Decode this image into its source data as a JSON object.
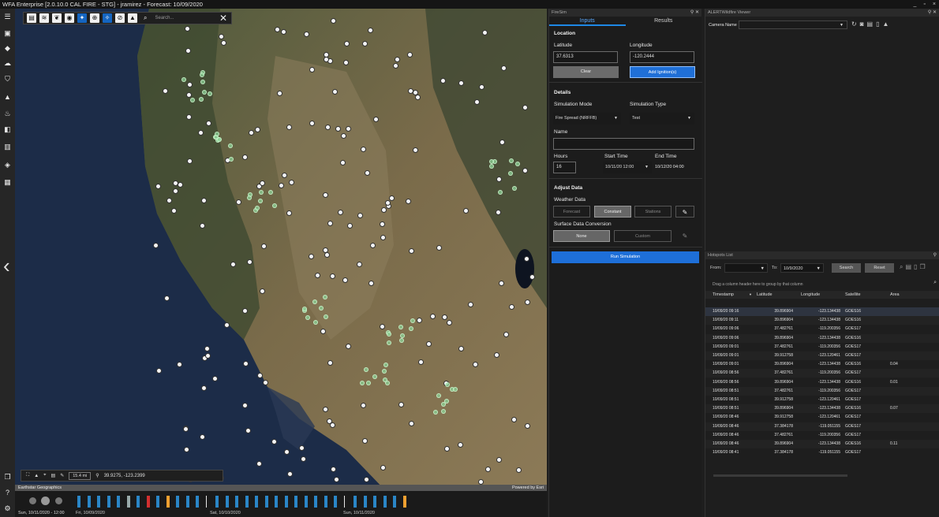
{
  "app": {
    "title": "WFA Enterprise [2.0.10.0 CAL FIRE - STG] - jramirez - Forecast: 10/09/2020"
  },
  "window_controls": [
    "_",
    "▫",
    "×"
  ],
  "map": {
    "search_placeholder": "Search...",
    "scale": "15.4 mi",
    "coords": "39.9275, -123.2399",
    "attribution_left": "Earthstar Geographics",
    "attribution_right": "Powered by Esri",
    "colors": {
      "ocean": "#1c2c48",
      "land": "#6b6346",
      "marker": "#f4f4f4",
      "hotspot": "#8fd29a"
    }
  },
  "timeline": {
    "current": "Sun, 10/11/2020 - 12:00",
    "dates": [
      "Fri, 10/09/2020",
      "Sat, 10/10/2020",
      "Sun, 10/11/2020"
    ]
  },
  "firesim": {
    "panel_title": "FireSim",
    "tabs": [
      "Inputs",
      "Results"
    ],
    "location": {
      "heading": "Location",
      "lat_label": "Latitude",
      "lat_value": "37.6313",
      "lon_label": "Longitude",
      "lon_value": "-120.2444",
      "clear": "Clear",
      "add": "Add Ignition(s)"
    },
    "details": {
      "heading": "Details",
      "mode_label": "Simulation Mode",
      "mode_value": "Fire Spread (NRFFB)",
      "type_label": "Simulation Type",
      "type_value": "Test",
      "name_label": "Name",
      "name_value": "",
      "hours_label": "Hours",
      "hours_value": "16",
      "start_label": "Start Time",
      "start_value": "10/11/20 12:00",
      "end_label": "End Time",
      "end_value": "10/12/20 04:00"
    },
    "adjust": {
      "heading": "Adjust Data",
      "weather_label": "Weather Data",
      "weather_opts": [
        "Forecast",
        "Constant",
        "Stations"
      ],
      "surface_label": "Surface Data Conversion",
      "surface_opts": [
        "None",
        "Custom"
      ]
    },
    "run": "Run Simulation"
  },
  "viewer": {
    "title": "ALERTWildfire Viewer",
    "camera_label": "Camera Name"
  },
  "hotspots": {
    "title": "Hotspots List",
    "from_label": "From:",
    "to_label": "To:",
    "to_value": "10/9/2020",
    "search": "Search",
    "reset": "Reset",
    "group_hint": "Drag a column header here to group by that column",
    "columns": [
      "Timestamp",
      "Latitude",
      "Longitude",
      "Satellite",
      "Area"
    ],
    "rows": [
      [
        "10/09/20 09:16",
        "39.896904",
        "-123.134438",
        "GOES16",
        ""
      ],
      [
        "10/09/20 09:11",
        "39.896904",
        "-123.134438",
        "GOES16",
        ""
      ],
      [
        "10/09/20 09:06",
        "37.482761",
        "-119.200356",
        "GOES17",
        ""
      ],
      [
        "10/09/20 09:06",
        "39.896904",
        "-123.134438",
        "GOES16",
        ""
      ],
      [
        "10/09/20 09:01",
        "37.482761",
        "-119.200356",
        "GOES17",
        ""
      ],
      [
        "10/09/20 09:01",
        "39.912758",
        "-123.120461",
        "GOES17",
        ""
      ],
      [
        "10/09/20 09:01",
        "39.896904",
        "-123.134438",
        "GOES16",
        "0.04"
      ],
      [
        "10/09/20 08:56",
        "37.482761",
        "-119.200356",
        "GOES17",
        ""
      ],
      [
        "10/09/20 08:56",
        "39.896904",
        "-123.134438",
        "GOES16",
        "0.01"
      ],
      [
        "10/09/20 08:51",
        "37.482761",
        "-119.200356",
        "GOES17",
        ""
      ],
      [
        "10/09/20 08:51",
        "39.912758",
        "-123.120461",
        "GOES17",
        ""
      ],
      [
        "10/09/20 08:51",
        "39.896904",
        "-123.134438",
        "GOES16",
        "0.07"
      ],
      [
        "10/09/20 08:46",
        "39.912758",
        "-123.120461",
        "GOES17",
        ""
      ],
      [
        "10/09/20 08:46",
        "37.384178",
        "-119.051155",
        "GOES17",
        ""
      ],
      [
        "10/09/20 08:46",
        "37.482761",
        "-119.200356",
        "GOES17",
        ""
      ],
      [
        "10/09/20 08:46",
        "39.896904",
        "-123.134438",
        "GOES16",
        "0.11"
      ],
      [
        "10/09/20 08:41",
        "37.384178",
        "-119.051155",
        "GOES17",
        ""
      ]
    ]
  }
}
